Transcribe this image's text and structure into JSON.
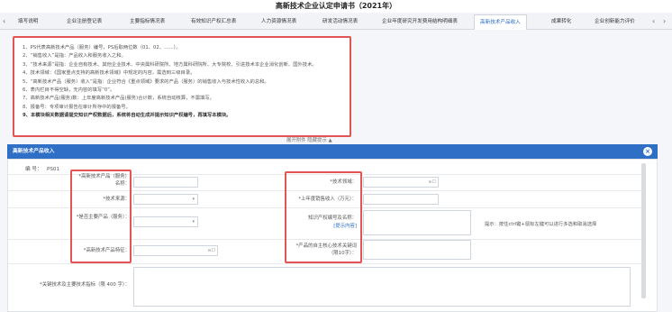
{
  "window": {
    "title": "高新技术企业认定申请书（2021年）"
  },
  "tabs": [
    {
      "label": "填写说明"
    },
    {
      "label": "企业注册登记表"
    },
    {
      "label": "主要指标情况表"
    },
    {
      "label": "有效知识产权汇总表"
    },
    {
      "label": "人力资源情况表"
    },
    {
      "label": "研发活动情况表"
    },
    {
      "label": "企业年度研究开发费用结构明细表"
    },
    {
      "label": "高新技术产品收入",
      "active": true
    },
    {
      "label": "成果转化"
    },
    {
      "label": "企业创新能力评价"
    }
  ],
  "notes": [
    "1、PS代表高新技术产品（服务）编号，PS后取两位数（01、02、……）。",
    "2、“销售收入”是指：产品收入和服务收入之和。",
    "3、“技术来源”是指：企业自有技术、其他企业技术、中央属科研院所、地方属科研院所、大专院校、引进技术本企业消化创新、国外技术。",
    "4、技术领域：《国家重点支持的高新技术领域》中规定的内容，需选到三级目录。",
    "5、“高新技术产品（服务）收入”是指：企业符合《重点领域》要求的产品（服务）的销售收入与技术性收入的总和。",
    "6、表内栏目不得空缺，无内容的填写“0”。",
    "7、高新技术产品(服务)数：上年度高新技术产品(服务)合计数，系统自动核算，不需填写。",
    "8、报备号：专项审计报告在审计所存中的报备号。",
    "9、本模块相关数据请提交知识产权数据后，系统将自动生成并提示知识产权编号，再填写本模块。"
  ],
  "collapse_label": "展开附件 隐藏提示 ▲",
  "dialog": {
    "title": "高新技术产品收入",
    "close_icon": "×",
    "number_label": "编  号：",
    "number_value": "PS01",
    "fields": {
      "name_label": "*高新技术产品（服务）名称：",
      "field_label": "*技术领域：",
      "field_ext": "≥☐",
      "source_label": "*技术来源：",
      "source_select": "",
      "revenue_label": "*上年度销售收入（万元）：",
      "is_main_label": "*是否主要产品（服务）：",
      "ip_label": "知识产权编号及名称：",
      "ip_link": "[提示内容]",
      "ip_hint": "提示：按住ctrl键+鼠标左键可以进行多选和取消选择",
      "feature_label": "*高新技术产品特征：",
      "feature_ext": "≥☐",
      "core_label": "*产品的自主核心技术关键词（限10字）：",
      "key_tech_label": "*关键技术及主要技术指标（限 400 字）："
    }
  },
  "colors": {
    "accent": "#2f6fc6",
    "highlight": "#e35454"
  }
}
